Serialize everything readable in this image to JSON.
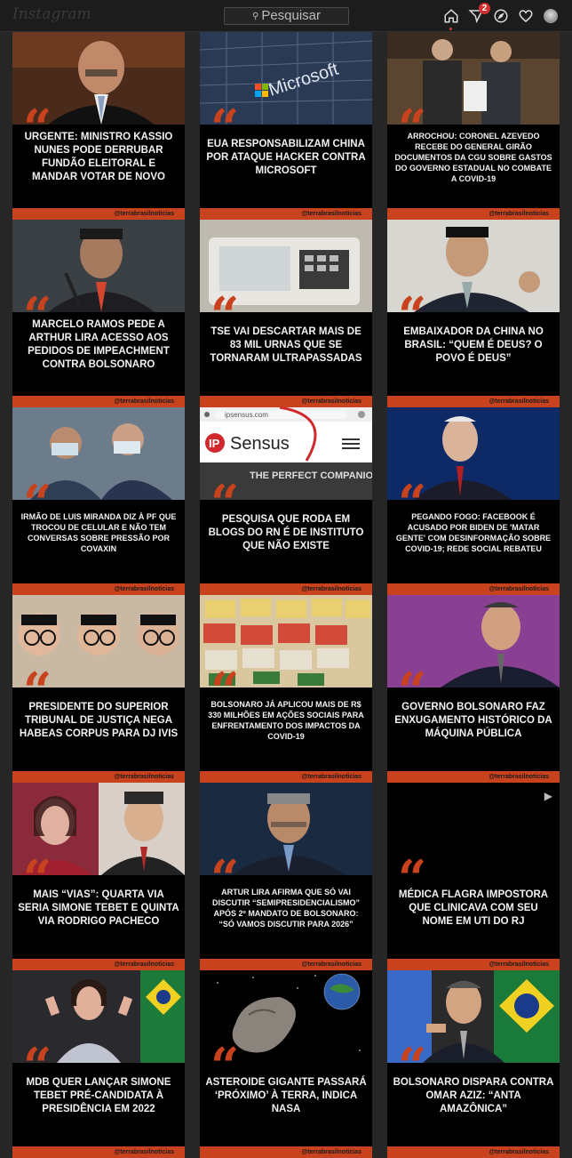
{
  "header": {
    "logo": "Instagram",
    "search_placeholder": "Pesquisar",
    "notification_count": "2"
  },
  "posts": [
    {
      "headline": "URGENTE: MINISTRO KASSIO NUNES PODE DERRUBAR FUNDÃO ELEITORAL E MANDAR VOTAR DE NOVO",
      "handle": "@terrabrasilnoticias",
      "photo": "judge-portrait"
    },
    {
      "headline": "EUA RESPONSABILIZAM CHINA POR ATAQUE HACKER CONTRA MICROSOFT",
      "handle": "@terrabrasilnoticias",
      "photo": "microsoft-building"
    },
    {
      "headline": "ARROCHOU: CORONEL AZEVEDO RECEBE DO GENERAL GIRÃO DOCUMENTOS DA CGU SOBRE GASTOS DO GOVERNO ESTADUAL NO COMBATE A COVID-19",
      "handle": "@terrabrasilnoticias",
      "photo": "two-men-documents"
    },
    {
      "headline": "MARCELO RAMOS PEDE A ARTHUR LIRA ACESSO AOS PEDIDOS DE IMPEACHMENT CONTRA BOLSONARO",
      "handle": "@terrabrasilnoticias",
      "photo": "man-microphone"
    },
    {
      "headline": "TSE VAI DESCARTAR MAIS DE 83 MIL URNAS QUE SE TORNARAM ULTRAPASSADAS",
      "handle": "@terrabrasilnoticias",
      "photo": "voting-machine"
    },
    {
      "headline": "EMBAIXADOR DA CHINA NO BRASIL: “QUEM É DEUS? O POVO É DEUS”",
      "handle": "@terrabrasilnoticias",
      "photo": "ambassador"
    },
    {
      "headline": "IRMÃO DE LUIS MIRANDA DIZ À PF QUE TROCOU DE CELULAR E NÃO TEM CONVERSAS SOBRE PRESSÃO POR COVAXIN",
      "handle": "@terrabrasilnoticias",
      "photo": "masked-men"
    },
    {
      "headline": "PESQUISA QUE RODA EM BLOGS DO RN É DE INSTITUTO QUE NÃO EXISTE",
      "handle": "@terrabrasilnoticias",
      "photo": "ipsensus-site",
      "site_url": "ipsensus.com",
      "site_logo": "IP",
      "site_name": "Sensus",
      "site_tagline": "THE PERFECT COMPANION FOR EVERY"
    },
    {
      "headline": "PEGANDO FOGO: FACEBOOK É ACUSADO POR BIDEN DE 'MATAR GENTE' COM DESINFORMAÇÃO SOBRE COVID-19; REDE SOCIAL REBATEU",
      "handle": "@terrabrasilnoticias",
      "photo": "biden"
    },
    {
      "headline": "PRESIDENTE DO SUPERIOR TRIBUNAL DE JUSTIÇA NEGA HABEAS CORPUS PARA DJ IVIS",
      "handle": "@terrabrasilnoticias",
      "photo": "man-glasses-triple"
    },
    {
      "headline": "BOLSONARO JÁ APLICOU MAIS DE R$ 330 MILHÕES EM AÇÕES SOCIAIS PARA ENFRENTAMENTO DOS IMPACTOS DA COVID-19",
      "handle": "@terrabrasilnoticias",
      "photo": "food-baskets"
    },
    {
      "headline": "GOVERNO BOLSONARO FAZ ENXUGAMENTO HISTÓRICO DA MÁQUINA PÚBLICA",
      "handle": "@terrabrasilnoticias",
      "photo": "bolsonaro-purple"
    },
    {
      "headline": "MAIS “VIAS”: QUARTA VIA SERIA SIMONE TEBET E QUINTA VIA RODRIGO PACHECO",
      "handle": "@terrabrasilnoticias",
      "photo": "tebet-pacheco"
    },
    {
      "headline": "ARTUR LIRA AFIRMA QUE SÓ VAI DISCUTIR “SEMIPRESIDENCIALISMO” APÓS 2º MANDATO DE BOLSONARO: “SÓ VAMOS DISCUTIR PARA 2026”",
      "handle": "@terrabrasilnoticias",
      "photo": "artur-lira"
    },
    {
      "headline": "MÉDICA FLAGRA IMPOSTORA QUE CLINICAVA COM SEU NOME EM UTI DO RJ",
      "handle": "@terrabrasilnoticias",
      "photo": "video-dark",
      "is_video": true
    },
    {
      "headline": "MDB QUER LANÇAR SIMONE TEBET PRÉ-CANDIDATA À PRESIDÊNCIA EM 2022",
      "handle": "@terrabrasilnoticias",
      "photo": "tebet-senate"
    },
    {
      "headline": "ASTEROIDE GIGANTE PASSARÁ ‘PRÓXIMO’ À TERRA, INDICA NASA",
      "handle": "@terrabrasilnoticias",
      "photo": "asteroid"
    },
    {
      "headline": "BOLSONARO DISPARA CONTRA OMAR AZIZ: “ANTA AMAZÔNICA”",
      "handle": "@terrabrasilnoticias",
      "photo": "bolsonaro-flag"
    }
  ],
  "colors": {
    "accent": "#c8421d",
    "background": "#262626",
    "card": "#000000"
  }
}
